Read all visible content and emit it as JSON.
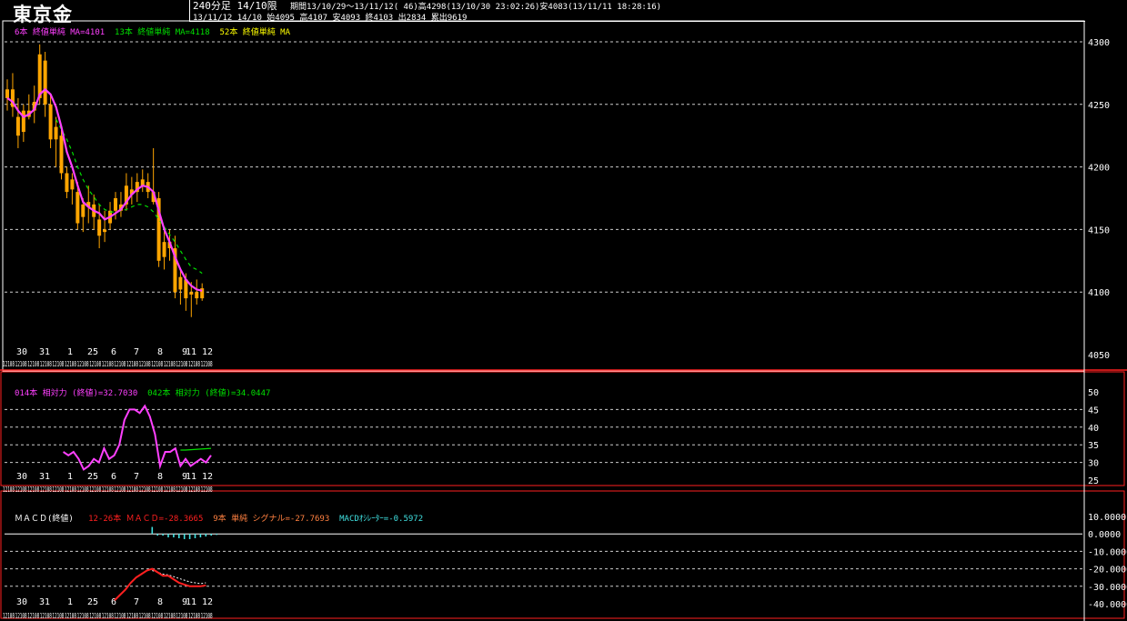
{
  "header": {
    "title": "東京金",
    "info_line1_timeframe": "240分足 14/10限",
    "info_line1_stats": "期間13/10/29～13/11/12( 46)高4298(13/10/30 23:02:26)安4083(13/11/11 18:28:16)",
    "info_line2": "13/11/12 14/10 始4095 高4107 安4093 終4103 出2834 累出9619"
  },
  "colors": {
    "candle": "#ffa500",
    "ma_short": "#ff40ff",
    "ma_mid": "#00e000",
    "ma_long": "#ffff00",
    "rsi14": "#ff40ff",
    "rsi42": "#00e000",
    "macd": "#ff2020",
    "signal": "#ffffff",
    "oscillator": "#40e0e0",
    "panel_border": "#ff2020"
  },
  "chart_data": [
    {
      "type": "candlestick",
      "legend": [
        {
          "text": "6本 終値単純 MA=4101",
          "color": "#ff40ff"
        },
        {
          "text": "13本 終値単純 MA=4118",
          "color": "#00e000"
        },
        {
          "text": "52本 終値単純 MA",
          "color": "#ffff00"
        }
      ],
      "ylim": [
        4050,
        4300
      ],
      "y_ticks": [
        "4300",
        "4250",
        "4200",
        "4150",
        "4100",
        "4050"
      ],
      "x_day_labels": [
        "30",
        "31",
        "1",
        "25",
        "6",
        "7",
        "8",
        "9",
        "11",
        "12"
      ],
      "date_stamp": "12108",
      "date_stamp_count": 17,
      "candles": [
        {
          "o": 4255,
          "h": 4270,
          "l": 4245,
          "c": 4262
        },
        {
          "o": 4262,
          "h": 4275,
          "l": 4240,
          "c": 4248
        },
        {
          "o": 4240,
          "h": 4255,
          "l": 4215,
          "c": 4225
        },
        {
          "o": 4228,
          "h": 4250,
          "l": 4220,
          "c": 4245
        },
        {
          "o": 4245,
          "h": 4258,
          "l": 4238,
          "c": 4240
        },
        {
          "o": 4245,
          "h": 4265,
          "l": 4235,
          "c": 4252
        },
        {
          "o": 4255,
          "h": 4298,
          "l": 4250,
          "c": 4290
        },
        {
          "o": 4285,
          "h": 4292,
          "l": 4240,
          "c": 4250
        },
        {
          "o": 4250,
          "h": 4258,
          "l": 4215,
          "c": 4222
        },
        {
          "o": 4222,
          "h": 4240,
          "l": 4200,
          "c": 4232
        },
        {
          "o": 4225,
          "h": 4230,
          "l": 4190,
          "c": 4195
        },
        {
          "o": 4195,
          "h": 4200,
          "l": 4175,
          "c": 4180
        },
        {
          "o": 4182,
          "h": 4195,
          "l": 4170,
          "c": 4190
        },
        {
          "o": 4180,
          "h": 4188,
          "l": 4150,
          "c": 4155
        },
        {
          "o": 4160,
          "h": 4175,
          "l": 4148,
          "c": 4170
        },
        {
          "o": 4168,
          "h": 4185,
          "l": 4155,
          "c": 4172
        },
        {
          "o": 4170,
          "h": 4178,
          "l": 4150,
          "c": 4160
        },
        {
          "o": 4158,
          "h": 4170,
          "l": 4135,
          "c": 4145
        },
        {
          "o": 4148,
          "h": 4165,
          "l": 4140,
          "c": 4150
        },
        {
          "o": 4155,
          "h": 4172,
          "l": 4150,
          "c": 4165
        },
        {
          "o": 4165,
          "h": 4180,
          "l": 4158,
          "c": 4175
        },
        {
          "o": 4170,
          "h": 4180,
          "l": 4160,
          "c": 4165
        },
        {
          "o": 4170,
          "h": 4195,
          "l": 4165,
          "c": 4185
        },
        {
          "o": 4182,
          "h": 4192,
          "l": 4170,
          "c": 4178
        },
        {
          "o": 4180,
          "h": 4195,
          "l": 4172,
          "c": 4188
        },
        {
          "o": 4185,
          "h": 4198,
          "l": 4180,
          "c": 4190
        },
        {
          "o": 4188,
          "h": 4195,
          "l": 4175,
          "c": 4180
        },
        {
          "o": 4180,
          "h": 4215,
          "l": 4170,
          "c": 4172
        },
        {
          "o": 4175,
          "h": 4180,
          "l": 4120,
          "c": 4125
        },
        {
          "o": 4128,
          "h": 4150,
          "l": 4118,
          "c": 4140
        },
        {
          "o": 4140,
          "h": 4150,
          "l": 4125,
          "c": 4135
        },
        {
          "o": 4135,
          "h": 4145,
          "l": 4095,
          "c": 4100
        },
        {
          "o": 4102,
          "h": 4118,
          "l": 4090,
          "c": 4112
        },
        {
          "o": 4110,
          "h": 4115,
          "l": 4085,
          "c": 4095
        },
        {
          "o": 4098,
          "h": 4108,
          "l": 4080,
          "c": 4100
        },
        {
          "o": 4100,
          "h": 4110,
          "l": 4090,
          "c": 4095
        },
        {
          "o": 4095,
          "h": 4107,
          "l": 4093,
          "c": 4103
        }
      ],
      "ma_short_values": [
        4255,
        4252,
        4245,
        4240,
        4242,
        4246,
        4258,
        4262,
        4258,
        4248,
        4232,
        4212,
        4200,
        4185,
        4172,
        4168,
        4165,
        4163,
        4158,
        4160,
        4163,
        4166,
        4172,
        4178,
        4182,
        4185,
        4184,
        4180,
        4165,
        4150,
        4140,
        4128,
        4118,
        4110,
        4105,
        4102,
        4101
      ],
      "ma_mid_values": [
        null,
        null,
        null,
        null,
        null,
        null,
        null,
        null,
        null,
        4238,
        4230,
        4222,
        4212,
        4200,
        4190,
        4182,
        4176,
        4170,
        4166,
        4164,
        4164,
        4165,
        4166,
        4168,
        4170,
        4170,
        4168,
        4164,
        4158,
        4152,
        4146,
        4140,
        4133,
        4126,
        4120,
        4118,
        4115
      ]
    },
    {
      "type": "line",
      "legend": [
        {
          "text": "014本 相対力 (終値)=32.7030",
          "color": "#ff40ff"
        },
        {
          "text": "042本 相対力 (終値)=34.0447",
          "color": "#00e000"
        }
      ],
      "ylim": [
        25,
        50
      ],
      "y_ticks": [
        "50",
        "45",
        "40",
        "35",
        "30",
        "25"
      ],
      "x_day_labels": [
        "30",
        "31",
        "1",
        "25",
        "6",
        "7",
        "8",
        "9",
        "11",
        "12"
      ],
      "series": [
        {
          "name": "014本 相対力",
          "values": [
            null,
            null,
            null,
            null,
            null,
            null,
            null,
            null,
            null,
            null,
            null,
            33,
            32,
            33,
            31,
            28,
            29,
            31,
            30,
            34,
            31,
            32,
            35,
            42,
            45,
            45,
            44,
            46,
            43,
            38,
            29,
            33,
            33,
            34,
            29,
            31,
            29,
            30,
            31,
            30,
            32
          ]
        },
        {
          "name": "042本 相対力",
          "values": [
            null,
            null,
            null,
            null,
            null,
            null,
            null,
            null,
            null,
            null,
            null,
            null,
            null,
            null,
            null,
            null,
            null,
            null,
            null,
            null,
            null,
            null,
            null,
            null,
            null,
            null,
            null,
            null,
            null,
            null,
            null,
            null,
            null,
            null,
            33.5,
            33.5,
            null,
            null,
            null,
            null,
            34
          ]
        }
      ]
    },
    {
      "type": "line",
      "legend": [
        {
          "text": "ＭＡＣＤ(終値)",
          "color": "#ffffff"
        },
        {
          "text": "12-26本 ＭＡＣＤ=-28.3665",
          "color": "#ff2020"
        },
        {
          "text": "9本 単純 シグナル=-27.7693",
          "color": "#ff8040"
        },
        {
          "text": "MACDｵｼﾚｰﾀｰ=-0.5972",
          "color": "#40e0e0"
        }
      ],
      "ylim": [
        -40,
        10
      ],
      "y_ticks": [
        "10.0000",
        "0.0000",
        "-10.0000",
        "-20.0000",
        "-30.0000",
        "-40.0000"
      ],
      "x_day_labels": [
        "30",
        "31",
        "1",
        "25",
        "6",
        "7",
        "8",
        "9",
        "11",
        "12"
      ],
      "series": [
        {
          "name": "12-26本 ＭＡＣＤ",
          "values": [
            null,
            null,
            null,
            null,
            null,
            null,
            null,
            null,
            null,
            null,
            null,
            null,
            null,
            null,
            null,
            null,
            null,
            null,
            null,
            null,
            -38,
            -35,
            -32,
            -28,
            -25,
            -23,
            -21,
            -20,
            -22,
            -24,
            -24,
            -26,
            -28,
            -29,
            -30,
            -30,
            -30,
            -29.5
          ]
        },
        {
          "name": "9本 単純 シグナル",
          "values": [
            null,
            null,
            null,
            null,
            null,
            null,
            null,
            null,
            null,
            null,
            null,
            null,
            null,
            null,
            null,
            null,
            null,
            null,
            null,
            null,
            null,
            null,
            null,
            null,
            null,
            null,
            null,
            -21,
            -22,
            -23,
            -23.5,
            -24.5,
            -25.5,
            -26.5,
            -27.5,
            -28,
            -28.5,
            -28
          ]
        },
        {
          "name": "MACDｵｼﾚｰﾀｰ",
          "values": [
            null,
            null,
            null,
            null,
            null,
            null,
            null,
            null,
            null,
            null,
            null,
            null,
            null,
            null,
            null,
            null,
            null,
            null,
            null,
            null,
            null,
            null,
            null,
            null,
            null,
            null,
            null,
            4,
            -1,
            -1,
            -2,
            -2,
            -2.5,
            -3,
            -3,
            -2.5,
            -2,
            -1.5,
            -1,
            -0.6
          ]
        }
      ]
    }
  ]
}
